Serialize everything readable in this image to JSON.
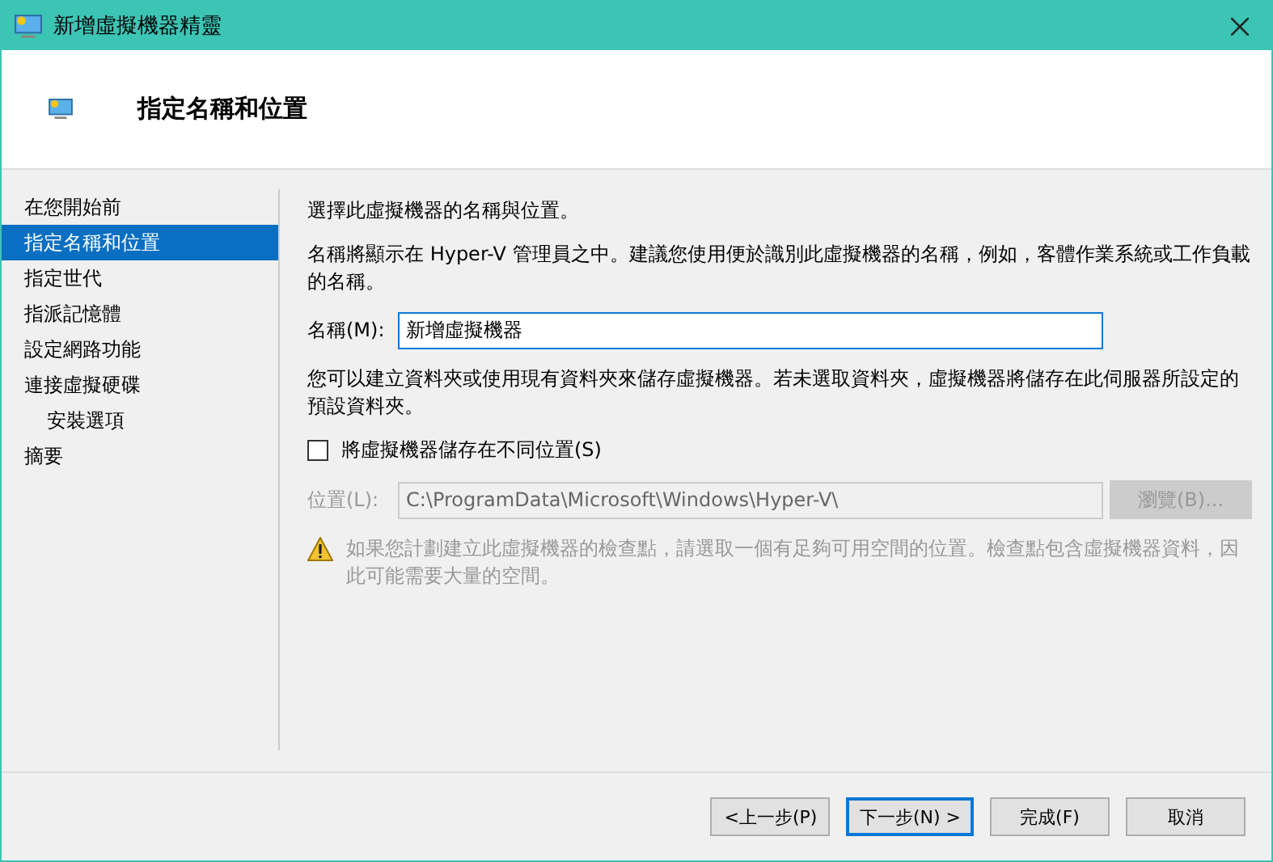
{
  "window": {
    "title": "新增虛擬機器精靈"
  },
  "header": {
    "title": "指定名稱和位置"
  },
  "nav": {
    "items": [
      {
        "label": "在您開始前",
        "selected": false
      },
      {
        "label": "指定名稱和位置",
        "selected": true
      },
      {
        "label": "指定世代",
        "selected": false
      },
      {
        "label": "指派記憶體",
        "selected": false
      },
      {
        "label": "設定網路功能",
        "selected": false
      },
      {
        "label": "連接虛擬硬碟",
        "selected": false,
        "children": [
          {
            "label": "安裝選項",
            "selected": false
          }
        ]
      },
      {
        "label": "摘要",
        "selected": false
      }
    ]
  },
  "content": {
    "intro": "選擇此虛擬機器的名稱與位置。",
    "name_hint": "名稱將顯示在 Hyper-V 管理員之中。建議您使用便於識別此虛擬機器的名稱，例如，客體作業系統或工作負載的名稱。",
    "name_field": {
      "label": "名稱(M):",
      "value": "新增虛擬機器"
    },
    "folder_hint": "您可以建立資料夾或使用現有資料夾來儲存虛擬機器。若未選取資料夾，虛擬機器將儲存在此伺服器所設定的預設資料夾。",
    "store_elsewhere": {
      "label": "將虛擬機器儲存在不同位置(S)",
      "checked": false
    },
    "location": {
      "label": "位置(L):",
      "value": "C:\\ProgramData\\Microsoft\\Windows\\Hyper-V\\",
      "disabled": true
    },
    "browse_button": {
      "label": "瀏覽(B)...",
      "disabled": true
    },
    "warning": "如果您計劃建立此虛擬機器的檢查點，請選取一個有足夠可用空間的位置。檢查點包含虛擬機器資料，因此可能需要大量的空間。"
  },
  "buttons": [
    {
      "label": "<上一步(P)",
      "default": false
    },
    {
      "label": "下一步(N) >",
      "default": true
    },
    {
      "label": "完成(F)",
      "default": false
    },
    {
      "label": "取消",
      "default": false
    }
  ]
}
